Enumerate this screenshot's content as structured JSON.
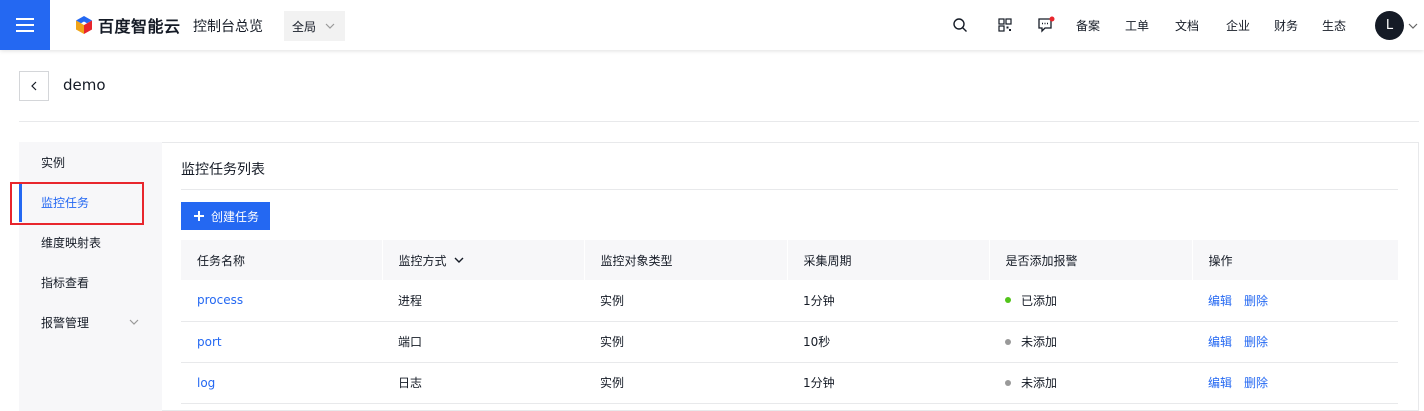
{
  "topbar": {
    "brand": "百度智能云",
    "console": "控制台总览",
    "region": "全局",
    "links": [
      "备案",
      "工单",
      "文档",
      "企业",
      "财务",
      "生态"
    ],
    "avatar_letter": "L"
  },
  "page": {
    "title": "demo"
  },
  "sidenav": {
    "items": [
      {
        "label": "实例"
      },
      {
        "label": "监控任务"
      },
      {
        "label": "维度映射表"
      },
      {
        "label": "指标查看"
      },
      {
        "label": "报警管理"
      }
    ]
  },
  "main": {
    "title": "监控任务列表",
    "create_label": "创建任务",
    "columns": [
      "任务名称",
      "监控方式",
      "监控对象类型",
      "采集周期",
      "是否添加报警",
      "操作"
    ],
    "rows": [
      {
        "name": "process",
        "method": "进程",
        "object": "实例",
        "period": "1分钟",
        "alarm": "已添加",
        "alarm_color": "#52c41a"
      },
      {
        "name": "port",
        "method": "端口",
        "object": "实例",
        "period": "10秒",
        "alarm": "未添加",
        "alarm_color": "#999999"
      },
      {
        "name": "log",
        "method": "日志",
        "object": "实例",
        "period": "1分钟",
        "alarm": "未添加",
        "alarm_color": "#999999"
      }
    ],
    "ops": {
      "edit": "编辑",
      "delete": "删除"
    }
  },
  "colors": {
    "accent": "#2468f2",
    "highlight": "#e8262d"
  }
}
